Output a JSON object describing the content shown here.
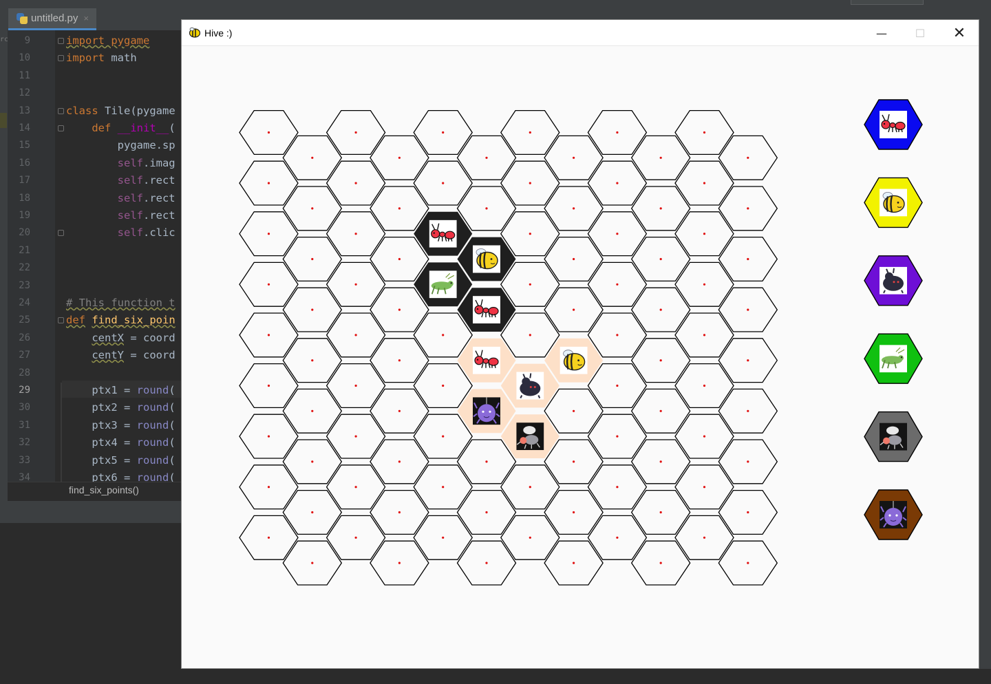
{
  "ide": {
    "file_tab": "untitled.py",
    "tab_close": "×",
    "left_strip_label": "rc",
    "breadcrumb": "find_six_points()",
    "lines": [
      {
        "n": "9",
        "code": "import pygame"
      },
      {
        "n": "10",
        "code": "import math"
      },
      {
        "n": "11",
        "code": ""
      },
      {
        "n": "12",
        "code": ""
      },
      {
        "n": "13",
        "code": "class Tile(pygame"
      },
      {
        "n": "14",
        "code": "    def __init__("
      },
      {
        "n": "15",
        "code": "        pygame.sp"
      },
      {
        "n": "16",
        "code": "        self.imag"
      },
      {
        "n": "17",
        "code": "        self.rect"
      },
      {
        "n": "18",
        "code": "        self.rect"
      },
      {
        "n": "19",
        "code": "        self.rect"
      },
      {
        "n": "20",
        "code": "        self.clic"
      },
      {
        "n": "21",
        "code": ""
      },
      {
        "n": "22",
        "code": ""
      },
      {
        "n": "23",
        "code": ""
      },
      {
        "n": "24",
        "code": "# This function t"
      },
      {
        "n": "25",
        "code": "def find_six_poin"
      },
      {
        "n": "26",
        "code": "    centX = coord"
      },
      {
        "n": "27",
        "code": "    centY = coord"
      },
      {
        "n": "28",
        "code": ""
      },
      {
        "n": "29",
        "code": "    ptx1 = round("
      },
      {
        "n": "30",
        "code": "    ptx2 = round("
      },
      {
        "n": "31",
        "code": "    ptx3 = round("
      },
      {
        "n": "32",
        "code": "    ptx4 = round("
      },
      {
        "n": "33",
        "code": "    ptx5 = round("
      },
      {
        "n": "34",
        "code": "    ptx6 = round("
      }
    ],
    "active_line": "29"
  },
  "window": {
    "title": "Hive :)",
    "minimize_glyph": "—",
    "maximize_glyph": "☐",
    "close_glyph": "✕"
  },
  "board": {
    "columns": 12,
    "rows_even_col": 9,
    "rows_odd_col": 9,
    "line_color": "#000000",
    "dot_color": "#e01010",
    "placed_black": [
      {
        "col": 4,
        "row": 2,
        "piece": "ant"
      },
      {
        "col": 5,
        "row": 2,
        "piece": "bee"
      },
      {
        "col": 4,
        "row": 3,
        "piece": "grasshopper"
      },
      {
        "col": 5,
        "row": 3,
        "piece": "ant"
      }
    ],
    "placed_white": [
      {
        "col": 5,
        "row": 4,
        "piece": "ant"
      },
      {
        "col": 7,
        "row": 4,
        "piece": "bee"
      },
      {
        "col": 6,
        "row": 5,
        "piece": "beetle"
      },
      {
        "col": 5,
        "row": 5,
        "piece": "spider"
      },
      {
        "col": 6,
        "row": 6,
        "piece": "mosquito"
      }
    ],
    "black_fill": "#1f1f1f",
    "white_fill": "#fde0c8"
  },
  "piece_selector": [
    {
      "piece": "ant",
      "color": "#0a0af0"
    },
    {
      "piece": "bee",
      "color": "#f2f200"
    },
    {
      "piece": "beetle",
      "color": "#6e0fd6"
    },
    {
      "piece": "grasshopper",
      "color": "#10c010"
    },
    {
      "piece": "mosquito",
      "color": "#6b6b6b"
    },
    {
      "piece": "spider",
      "color": "#7a3a05"
    }
  ]
}
